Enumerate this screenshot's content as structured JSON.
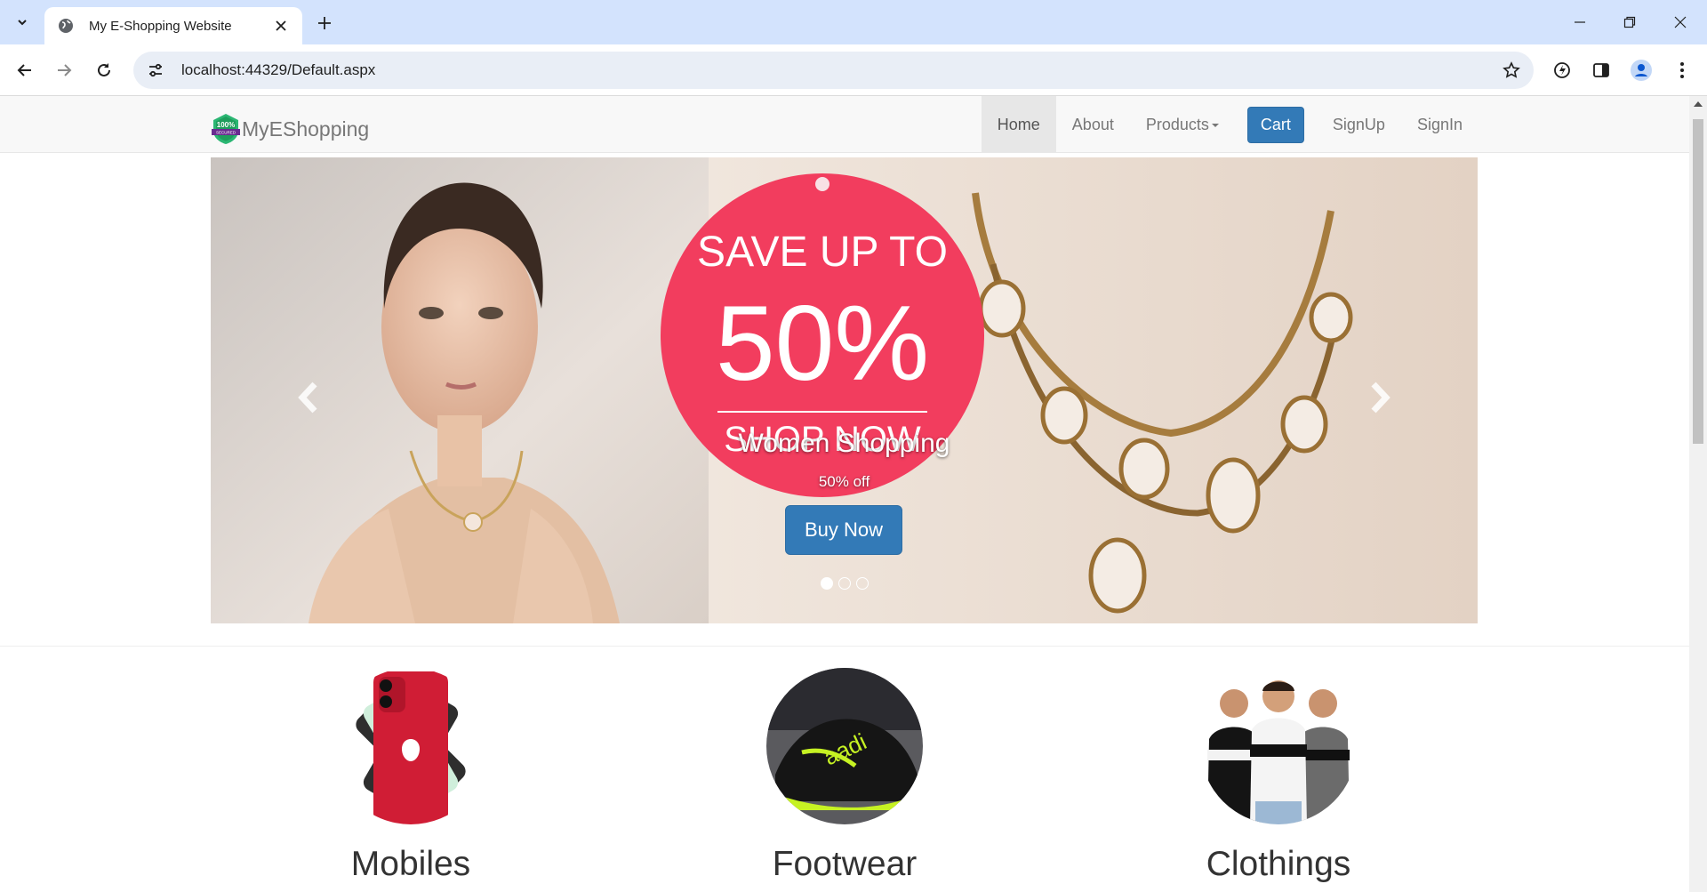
{
  "browser": {
    "tab_title": "My E-Shopping Website",
    "url": "localhost:44329/Default.aspx"
  },
  "site": {
    "brand": "MyEShopping",
    "logo_text": "100% SECURED",
    "nav": {
      "home": "Home",
      "about": "About",
      "products": "Products",
      "cart": "Cart",
      "signup": "SignUp",
      "signin": "SignIn"
    },
    "accent_color": "#337ab7"
  },
  "carousel": {
    "tag_line1": "SAVE UP  TO",
    "tag_line2": "50%",
    "tag_line3": "SHOP NOW",
    "caption_title": "Women Shopping",
    "caption_sub": "50% off",
    "button": "Buy Now",
    "slides": 3,
    "active_slide": 1
  },
  "categories": [
    {
      "name": "Mobiles",
      "icon": "phone-icon"
    },
    {
      "name": "Footwear",
      "icon": "shoe-icon"
    },
    {
      "name": "Clothings",
      "icon": "shirt-icon"
    }
  ]
}
